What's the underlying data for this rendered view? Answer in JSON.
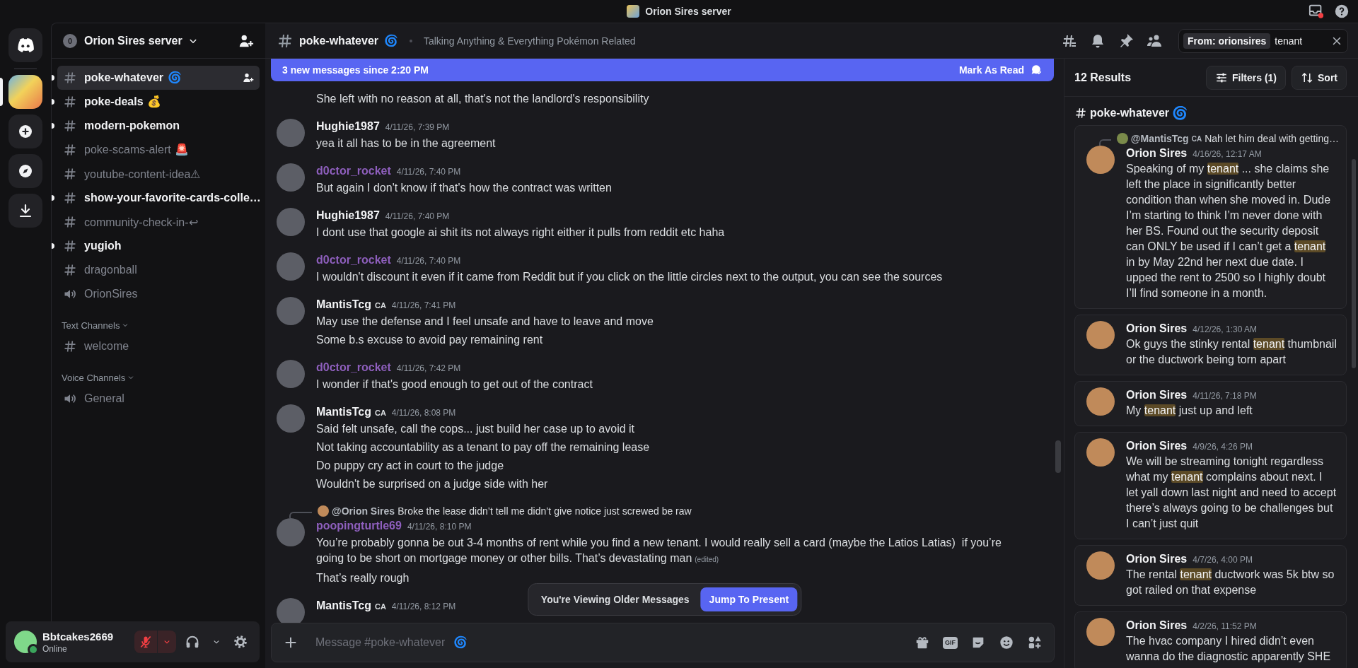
{
  "titlebar": {
    "title": "Orion Sires server"
  },
  "server_rail": {
    "items": [
      {
        "kind": "home",
        "selected": false
      },
      {
        "kind": "server",
        "selected": true
      },
      {
        "kind": "add",
        "selected": false
      },
      {
        "kind": "discover",
        "selected": false
      },
      {
        "kind": "download",
        "selected": false
      }
    ]
  },
  "sidebar": {
    "boost_badge": "0",
    "server_name": "Orion Sires server",
    "channels": [
      {
        "name": "poke-whatever",
        "kind": "text",
        "emoji": "🌀",
        "unread": true,
        "selected": true
      },
      {
        "name": "poke-deals",
        "kind": "text",
        "emoji": "💰",
        "unread": true,
        "selected": false
      },
      {
        "name": "modern-pokemon",
        "kind": "text",
        "unread": true,
        "selected": false
      },
      {
        "name": "poke-scams-alert",
        "kind": "text",
        "emoji": "🚨",
        "unread": false,
        "selected": false
      },
      {
        "name": "youtube-content-idea⚠",
        "kind": "text",
        "unread": false,
        "selected": false
      },
      {
        "name": "show-your-favorite-cards-colle…",
        "kind": "text",
        "unread": true,
        "selected": false
      },
      {
        "name": "community-check-in-↩",
        "kind": "text",
        "unread": false,
        "selected": false
      },
      {
        "name": "yugioh",
        "kind": "text",
        "unread": true,
        "selected": false
      },
      {
        "name": "dragonball",
        "kind": "text",
        "unread": false,
        "selected": false
      },
      {
        "name": "OrionSires",
        "kind": "voice",
        "unread": false,
        "selected": false
      }
    ],
    "categories": [
      {
        "label": "Text Channels",
        "channels": [
          {
            "name": "welcome",
            "kind": "text",
            "unread": false,
            "selected": false
          }
        ]
      },
      {
        "label": "Voice Channels",
        "channels": [
          {
            "name": "General",
            "kind": "voice",
            "unread": false,
            "selected": false
          }
        ]
      }
    ]
  },
  "user_panel": {
    "name": "Bbtcakes2669",
    "status": "Online",
    "muted": true
  },
  "channel_header": {
    "name": "poke-whatever",
    "emoji": "🌀",
    "topic": "Talking Anything & Everything Pokémon Related",
    "search": {
      "filter_chip": "From: orionsires",
      "value": "tenant"
    }
  },
  "new_messages_banner": {
    "text": "3 new messages since 2:20 PM",
    "action": "Mark As Read"
  },
  "messages": [
    {
      "lines": [
        {
          "text": "She left with no reason at all, that's not the landlord's responsibility"
        }
      ]
    },
    {
      "author": "Hughie1987",
      "color": "#f2f3f5",
      "timestamp": "4/11/26, 7:39 PM",
      "lines": [
        {
          "text": "yea it all has to be in the agreement"
        }
      ]
    },
    {
      "author": "d0ctor_rocket",
      "color": "#8e5fbd",
      "timestamp": "4/11/26, 7:40 PM",
      "lines": [
        {
          "text": "But again I don't know if that's how the contract was written"
        }
      ]
    },
    {
      "author": "Hughie1987",
      "color": "#f2f3f5",
      "timestamp": "4/11/26, 7:40 PM",
      "lines": [
        {
          "text": "I dont use that google ai shit its not always right either it pulls from reddit etc haha"
        }
      ]
    },
    {
      "author": "d0ctor_rocket",
      "color": "#8e5fbd",
      "timestamp": "4/11/26, 7:40 PM",
      "lines": [
        {
          "text": "I wouldn't discount it even if it came from Reddit but if you click on the little circles next to the output, you can see the sources"
        }
      ]
    },
    {
      "author": "MantisTcg",
      "color": "#f2f3f5",
      "tag": "CA",
      "timestamp": "4/11/26, 7:41 PM",
      "lines": [
        {
          "text": "May use the defense and I feel unsafe and have to leave and move"
        },
        {
          "text": "Some b.s excuse to avoid pay remaining rent"
        }
      ]
    },
    {
      "author": "d0ctor_rocket",
      "color": "#8e5fbd",
      "timestamp": "4/11/26, 7:42 PM",
      "lines": [
        {
          "text": "I wonder if that's good enough to get out of the contract"
        }
      ]
    },
    {
      "author": "MantisTcg",
      "color": "#f2f3f5",
      "tag": "CA",
      "timestamp": "4/11/26, 8:08 PM",
      "lines": [
        {
          "text": "Said felt unsafe, call the cops... just build her case up to avoid it"
        },
        {
          "text": "Not taking accountability as a tenant to pay off the remaining lease"
        },
        {
          "text": "Do puppy cry act in court to the judge"
        },
        {
          "text": "Wouldn't be surprised on a judge side with her"
        }
      ]
    },
    {
      "author": "poopingturtle69",
      "color": "#8e5fbd",
      "timestamp": "4/11/26, 8:10 PM",
      "reply": {
        "author": "@Orion Sires",
        "text": "Broke the lease didn’t tell me didn’t give notice just screwed be raw"
      },
      "lines": [
        {
          "text": "You’re probably gonna be out 3-4 months of rent while you find a new tenant. I would really sell a card (maybe the Latios Latias)  if you’re going to be short on mortgage money or other bills. That’s devastating man",
          "edited": "(edited)"
        },
        {
          "text": "That’s really rough"
        }
      ]
    },
    {
      "author": "MantisTcg",
      "color": "#f2f3f5",
      "tag": "CA",
      "timestamp": "4/11/26, 8:12 PM"
    }
  ],
  "older_messages_bar": {
    "text": "You're Viewing Older Messages",
    "action": "Jump To Present"
  },
  "composer": {
    "placeholder": "Message #poke-whatever",
    "gif_label": "GIF"
  },
  "search_results": {
    "count_label": "12 Results",
    "filters_label": "Filters (1)",
    "sort_label": "Sort",
    "channel": "poke-whatever",
    "results": [
      {
        "author": "Orion Sires",
        "timestamp": "4/16/26, 12:17 AM",
        "reply": {
          "author": "@MantisTcg",
          "tag": "CA",
          "text": "Nah let him deal with getting…"
        },
        "segments": [
          {
            "text": "Speaking of my ",
            "highlight": false
          },
          {
            "text": "tenant",
            "highlight": true
          },
          {
            "text": " ... she claims she left the place in significantly better condition than when she moved in. Dude I’m starting to think I’m never done with her BS. Found out the security deposit can ONLY be used if I can’t get a ",
            "highlight": false
          },
          {
            "text": "tenant",
            "highlight": true
          },
          {
            "text": " in by May 22nd her next due date. I upped the rent to 2500 so I highly doubt I’ll find someone in a month.",
            "highlight": false
          }
        ]
      },
      {
        "author": "Orion Sires",
        "timestamp": "4/12/26, 1:30 AM",
        "segments": [
          {
            "text": "Ok guys the stinky rental ",
            "highlight": false
          },
          {
            "text": "tenant",
            "highlight": true
          },
          {
            "text": " thumbnail or the ductwork being torn apart",
            "highlight": false
          }
        ]
      },
      {
        "author": "Orion Sires",
        "timestamp": "4/11/26, 7:18 PM",
        "segments": [
          {
            "text": "My ",
            "highlight": false
          },
          {
            "text": "tenant",
            "highlight": true
          },
          {
            "text": " just up and left",
            "highlight": false
          }
        ]
      },
      {
        "author": "Orion Sires",
        "timestamp": "4/9/26, 4:26 PM",
        "segments": [
          {
            "text": "We will be streaming tonight regardless what my ",
            "highlight": false
          },
          {
            "text": "tenant",
            "highlight": true
          },
          {
            "text": " complains about next. I let yall down last night and need to accept there’s always going to be challenges but I can’t just quit",
            "highlight": false
          }
        ]
      },
      {
        "author": "Orion Sires",
        "timestamp": "4/7/26, 4:00 PM",
        "segments": [
          {
            "text": "The rental ",
            "highlight": false
          },
          {
            "text": "tenant",
            "highlight": true
          },
          {
            "text": " ductwork was 5k btw so got railed on that expense",
            "highlight": false
          }
        ]
      },
      {
        "author": "Orion Sires",
        "timestamp": "4/2/26, 11:52 PM",
        "segments": [
          {
            "text": "The hvac company I hired didn’t even wanna do the diagnostic apparently SHE",
            "highlight": false
          }
        ]
      }
    ]
  }
}
